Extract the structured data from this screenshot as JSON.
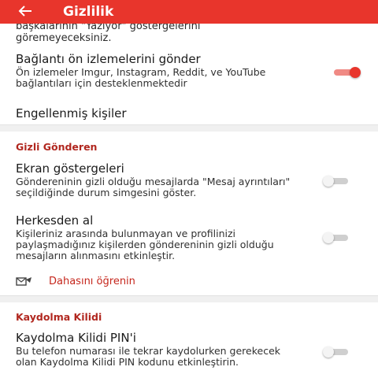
{
  "appbar": {
    "title": "Gizlilik",
    "back_icon": "arrow-left-icon",
    "color": "#e8352c"
  },
  "clipped_text": {
    "line1": "başkalarının \"Yazıyor\" göstergelerini",
    "line2": "göremeyeceksiniz."
  },
  "link_previews": {
    "title": "Bağlantı ön izlemelerini gönder",
    "subtitle": "Ön izlemeler Imgur, Instagram, Reddit, ve YouTube bağlantıları için desteklenmektedir",
    "enabled": true
  },
  "blocked": {
    "title": "Engellenmiş kişiler"
  },
  "sealed_sender": {
    "header": "Gizli Gönderen",
    "indicators": {
      "title": "Ekran göstergeleri",
      "subtitle": "Göndereninin gizli olduğu mesajlarda \"Mesaj ayrıntıları\" seçildiğinde durum simgesini göster.",
      "enabled": false
    },
    "allow_all": {
      "title": "Herkesden al",
      "subtitle": "Kişileriniz arasında bulunmayan ve profilinizi paylaşmadığınız kişilerden göndereninin gizli olduğu mesajların alınmasını etkinleştir.",
      "enabled": false
    },
    "learn_more": "Dahasını öğrenin",
    "learn_more_icon": "sealed-sender-icon"
  },
  "registration_lock": {
    "header": "Kaydolma Kilidi",
    "title": "Kaydolma Kilidi PIN'i",
    "subtitle": "Bu telefon numarası ile tekrar kaydolurken gerekecek olan Kaydolma Kilidi PIN kodunu etkinleştirin.",
    "enabled": false
  }
}
